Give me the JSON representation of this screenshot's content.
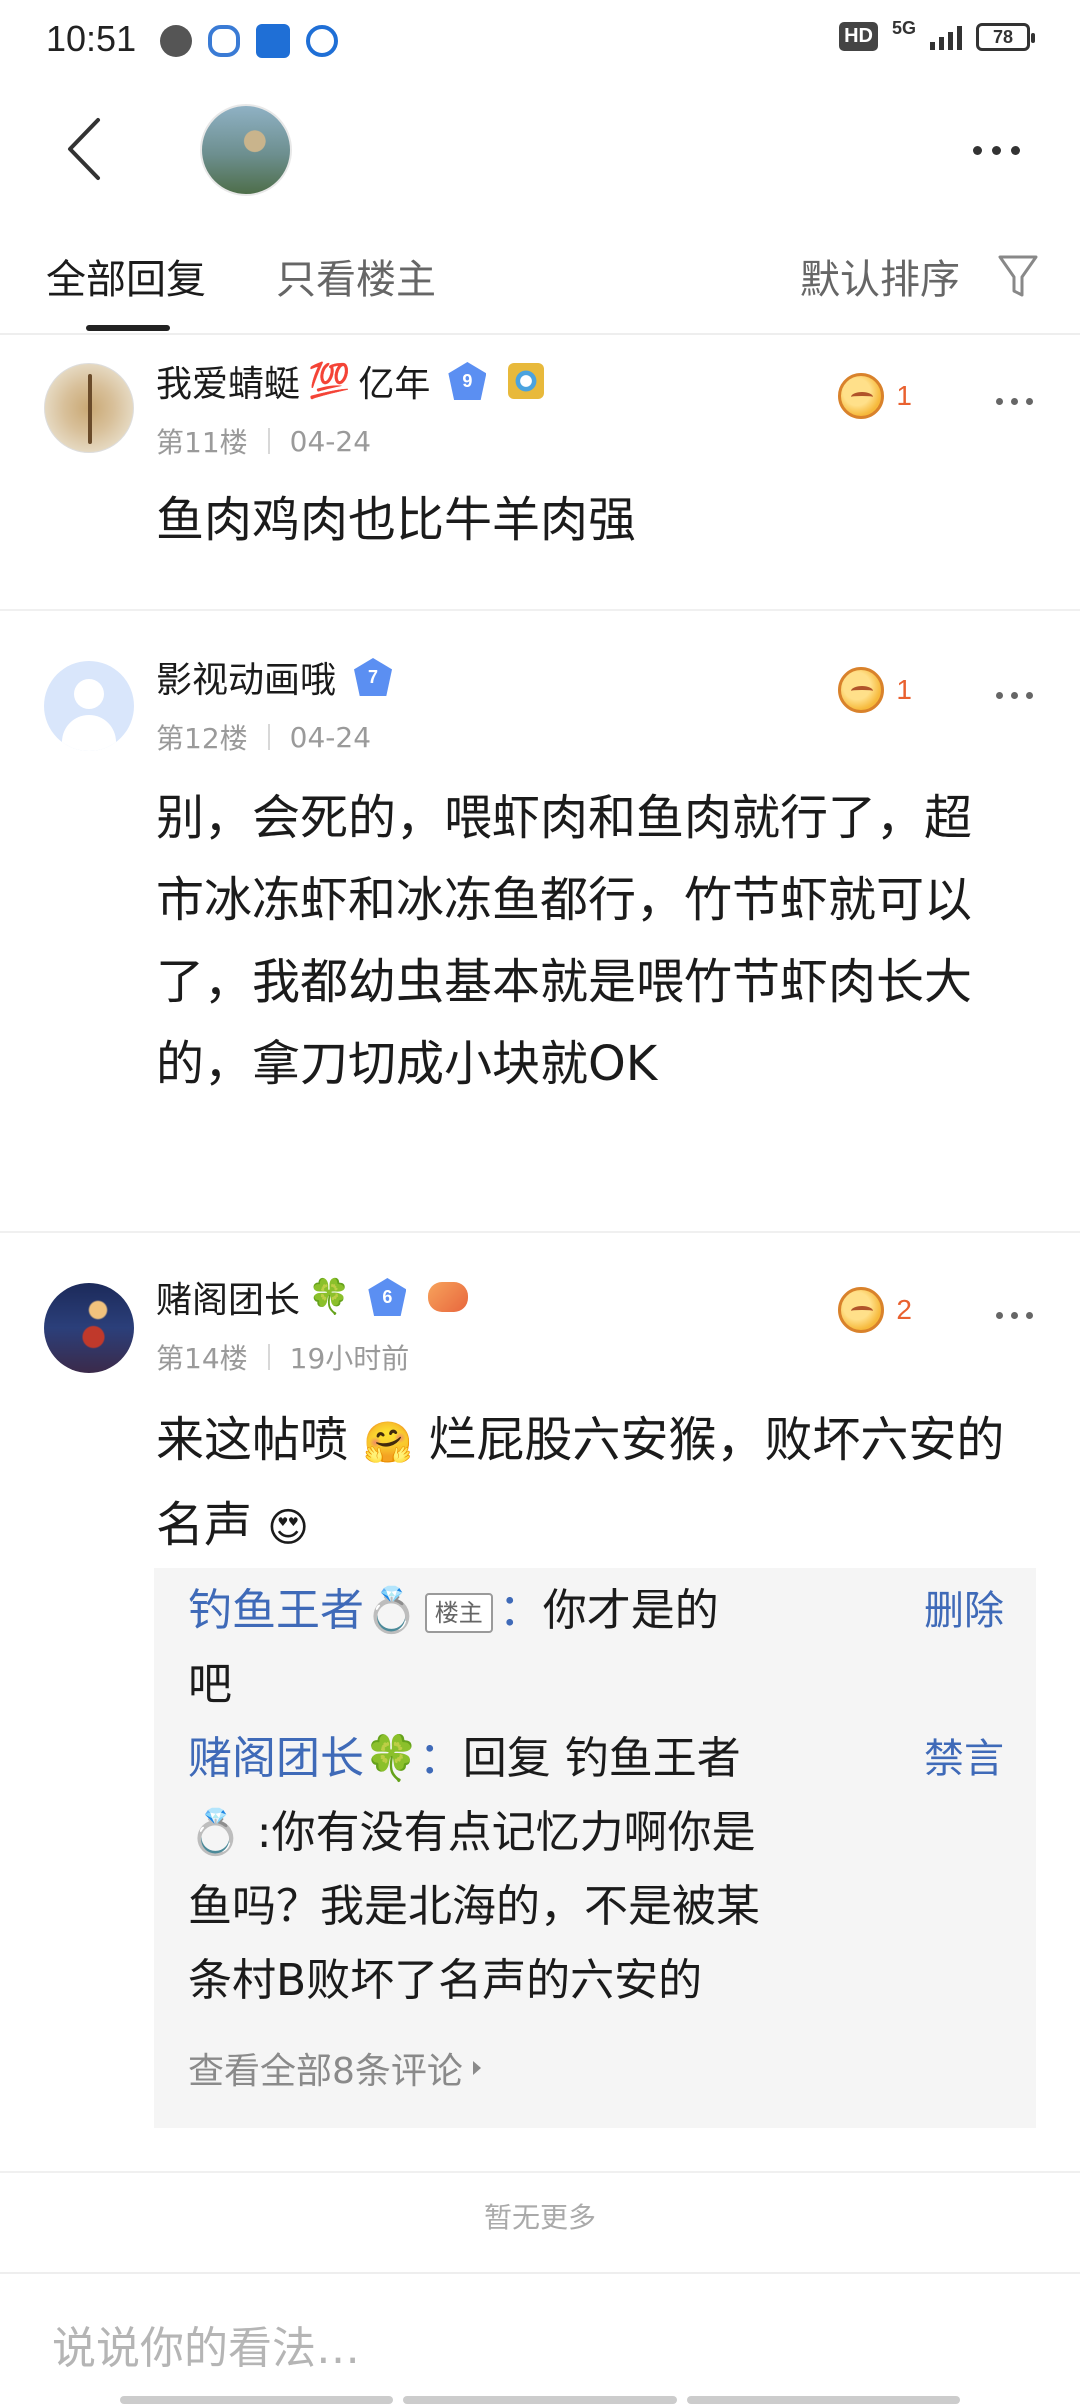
{
  "status_bar": {
    "time": "10:51",
    "hd": "HD",
    "network": "5G",
    "battery": "78"
  },
  "tabs": {
    "all_replies": "全部回复",
    "op_only": "只看楼主",
    "sort": "默认排序"
  },
  "posts": [
    {
      "username": "我爱蜻蜓",
      "username_emoji": "💯",
      "username_suffix": "亿年",
      "level": "9",
      "floor": "第11楼",
      "date": "04-24",
      "likes": "1",
      "content": "鱼肉鸡肉也比牛羊肉强"
    },
    {
      "username": "影视动画哦",
      "level": "7",
      "floor": "第12楼",
      "date": "04-24",
      "likes": "1",
      "content": "别，会死的，喂虾肉和鱼肉就行了，超市冰冻虾和冰冻鱼都行，竹节虾就可以了，我都幼虫基本就是喂竹节虾肉长大的，拿刀切成小块就OK"
    },
    {
      "username": "赌阁团长",
      "username_emoji": "🍀",
      "level": "6",
      "floor": "第14楼",
      "date": "19小时前",
      "likes": "2",
      "content_part1": "来这帖喷",
      "content_emoji1": "🤗",
      "content_part2": "烂屁股六安猴，败坏六安的名声",
      "content_emoji2": "😍"
    }
  ],
  "replies": {
    "r1_user": "钓鱼王者💍",
    "r1_tag": "楼主",
    "r1_colon": "：",
    "r1_text_line1": "你才是的",
    "r1_text_line2": "吧",
    "r1_action": "删除",
    "r2_user": "赌阁团长🍀：",
    "r2_text_line1": "回复  钓鱼王者",
    "r2_text_line2": "💍  :你有没有点记忆力啊你是",
    "r2_text_line3": "鱼吗？我是北海的，不是被某",
    "r2_text_line4": "条村B败坏了名声的六安的",
    "r2_action": "禁言",
    "view_all": "查看全部8条评论"
  },
  "footer": {
    "no_more": "暂无更多",
    "comment_placeholder": "说说你的看法…"
  }
}
